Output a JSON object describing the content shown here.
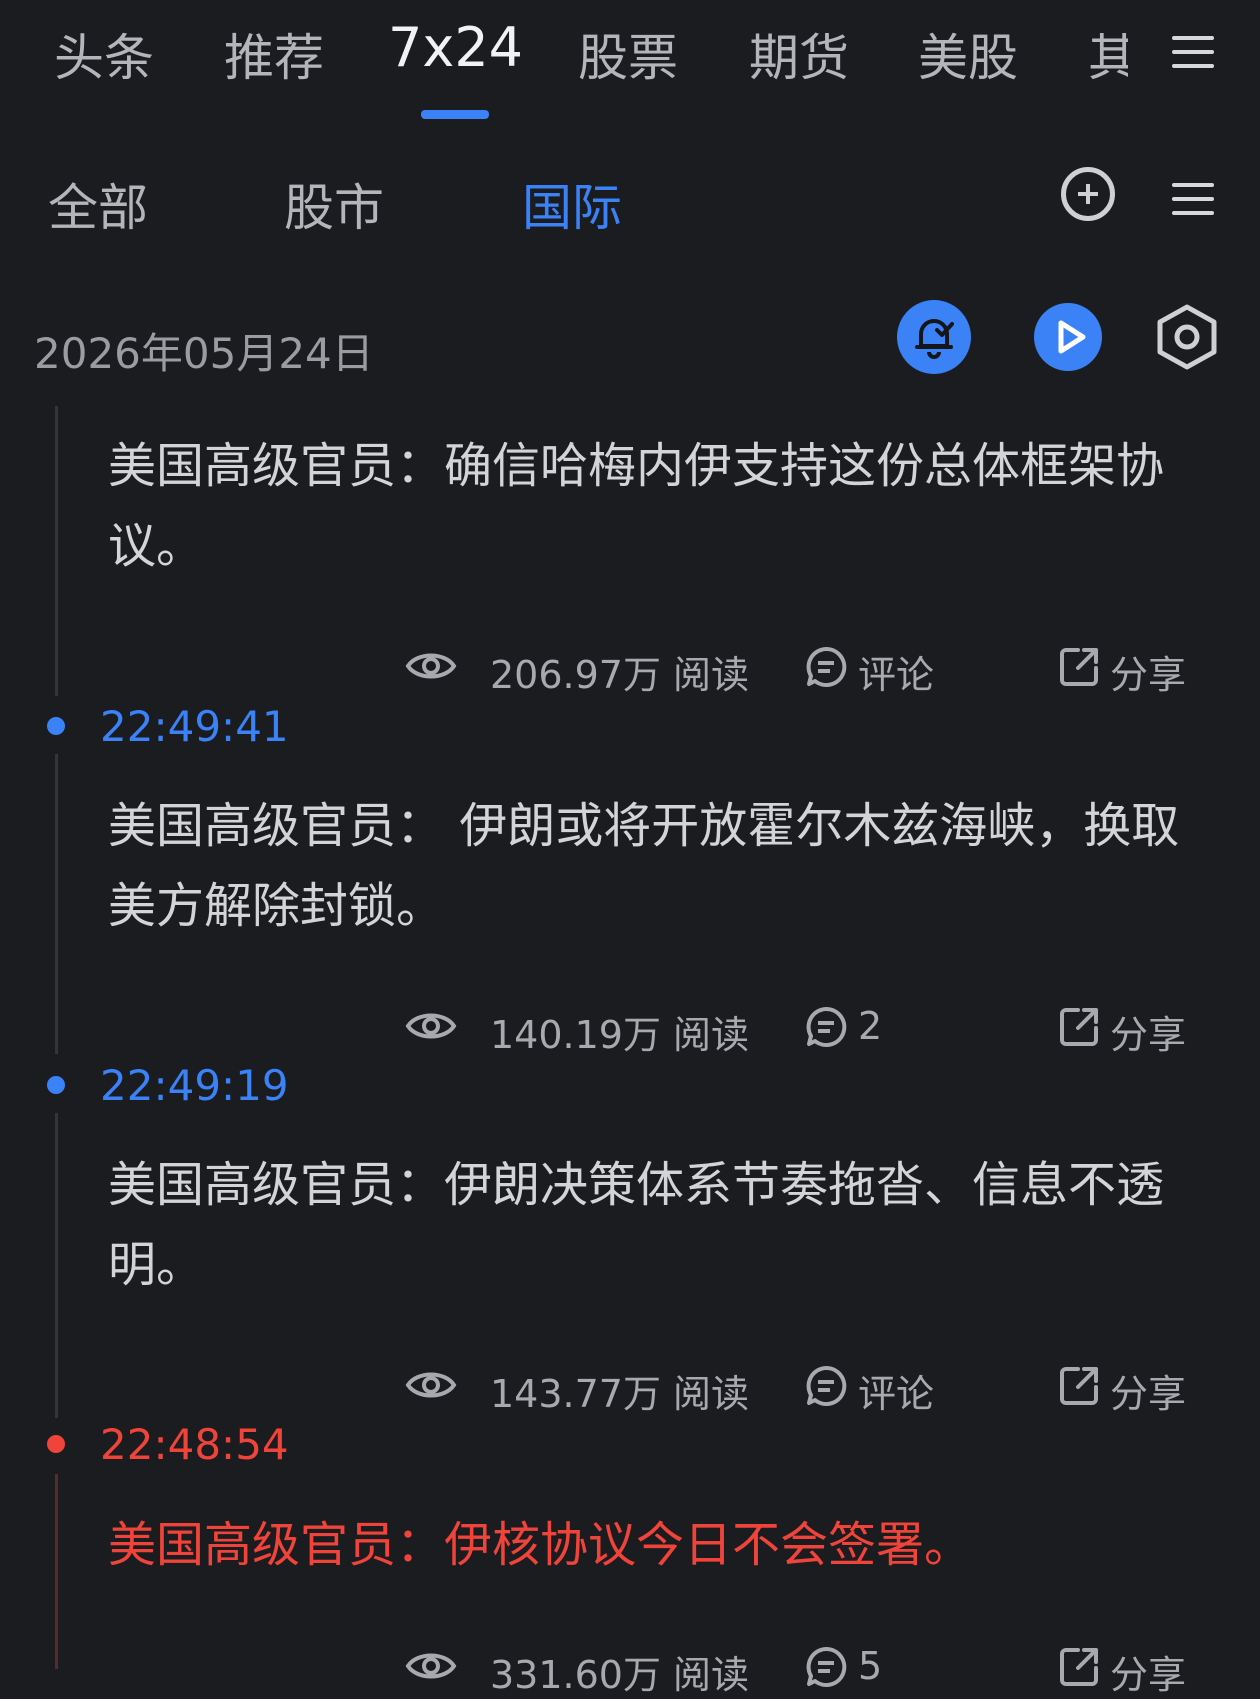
{
  "top_tabs": [
    "头条",
    "推荐",
    "7x24",
    "股票",
    "期货",
    "美股",
    "其"
  ],
  "sub_tabs": [
    "全部",
    "股市",
    "国际"
  ],
  "date": "2026年05月24日",
  "news": [
    {
      "time": "",
      "text": "美国高级官员：确信哈梅内伊支持这份总体框架协议。",
      "views": "206.97万 阅读",
      "comment": "评论",
      "share": "分享"
    },
    {
      "time": "22:49:41",
      "text": "美国高级官员： 伊朗或将开放霍尔木兹海峡，换取美方解除封锁。",
      "views": "140.19万 阅读",
      "comment": "2",
      "share": "分享"
    },
    {
      "time": "22:49:19",
      "text": "美国高级官员：伊朗决策体系节奏拖沓、信息不透明。",
      "views": "143.77万 阅读",
      "comment": "评论",
      "share": "分享"
    },
    {
      "time": "22:48:54",
      "text": "美国高级官员：伊核协议今日不会签署。",
      "views": "331.60万 阅读",
      "comment": "5",
      "share": "分享"
    }
  ],
  "colors": {
    "accent": "#3a82f6",
    "alert": "#f0443a",
    "background": "#1b1c20"
  }
}
